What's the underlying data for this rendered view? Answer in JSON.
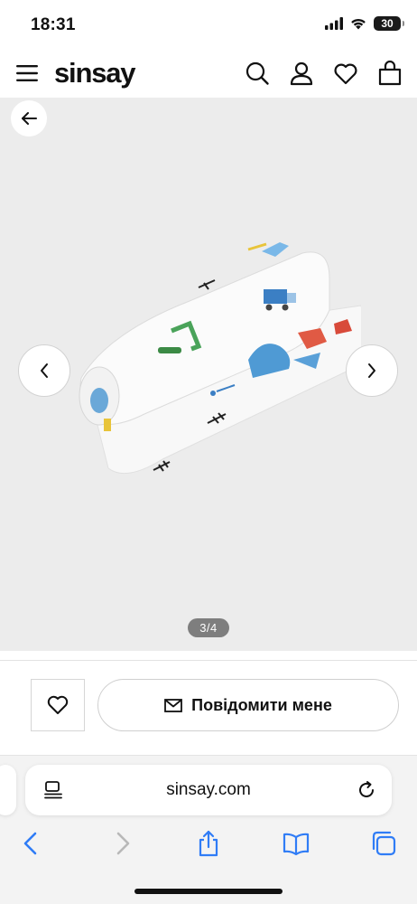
{
  "status_bar": {
    "time": "18:31",
    "battery": "30"
  },
  "header": {
    "logo": "sinsay",
    "icons": [
      "menu-icon",
      "search-icon",
      "account-icon",
      "heart-icon",
      "bag-icon"
    ]
  },
  "gallery": {
    "counter": "3/4",
    "colors": {
      "background": "#ececec"
    }
  },
  "actions": {
    "notify_label": "Повідомити мене"
  },
  "browser": {
    "url": "sinsay.com",
    "colors": {
      "accent": "#2f7cf6",
      "disabled": "#b8b8b8"
    }
  }
}
